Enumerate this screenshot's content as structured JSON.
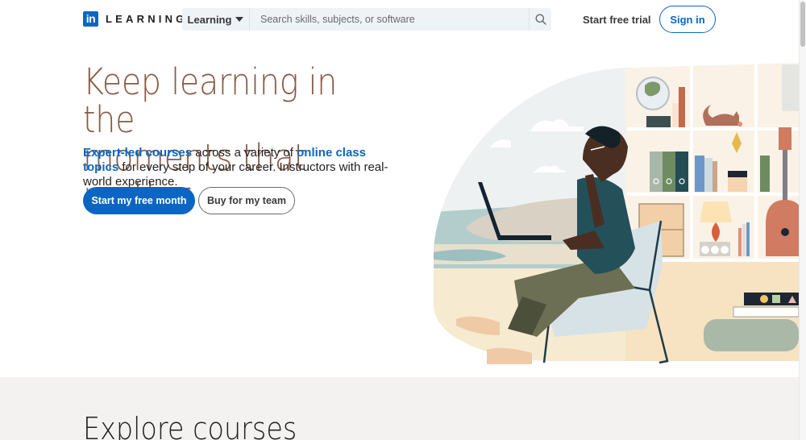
{
  "header": {
    "logo_mark": "in",
    "logo_text": "LEARNING",
    "search_type": "Learning",
    "search_placeholder": "Search skills, subjects, or software",
    "search_value": "",
    "start_trial": "Start free trial",
    "sign_in": "Sign in"
  },
  "hero": {
    "title_line1": "Keep learning in the",
    "title_line2": "moments that matter",
    "desc_link1": "Expert-led courses",
    "desc_text1": " across a variety of ",
    "desc_link2": "online class topics",
    "desc_text2": " for every step of your career. Instructors with real-world experience.",
    "primary_button": "Start my free month",
    "secondary_button": "Buy for my team",
    "illustration": "person-with-laptop-in-chair-illustration"
  },
  "explore": {
    "title": "Explore courses"
  },
  "colors": {
    "brand": "#0a66c2",
    "title": "#8a5a44",
    "search_bg": "#eef3f8",
    "explore_bg": "#f3f2f0"
  }
}
